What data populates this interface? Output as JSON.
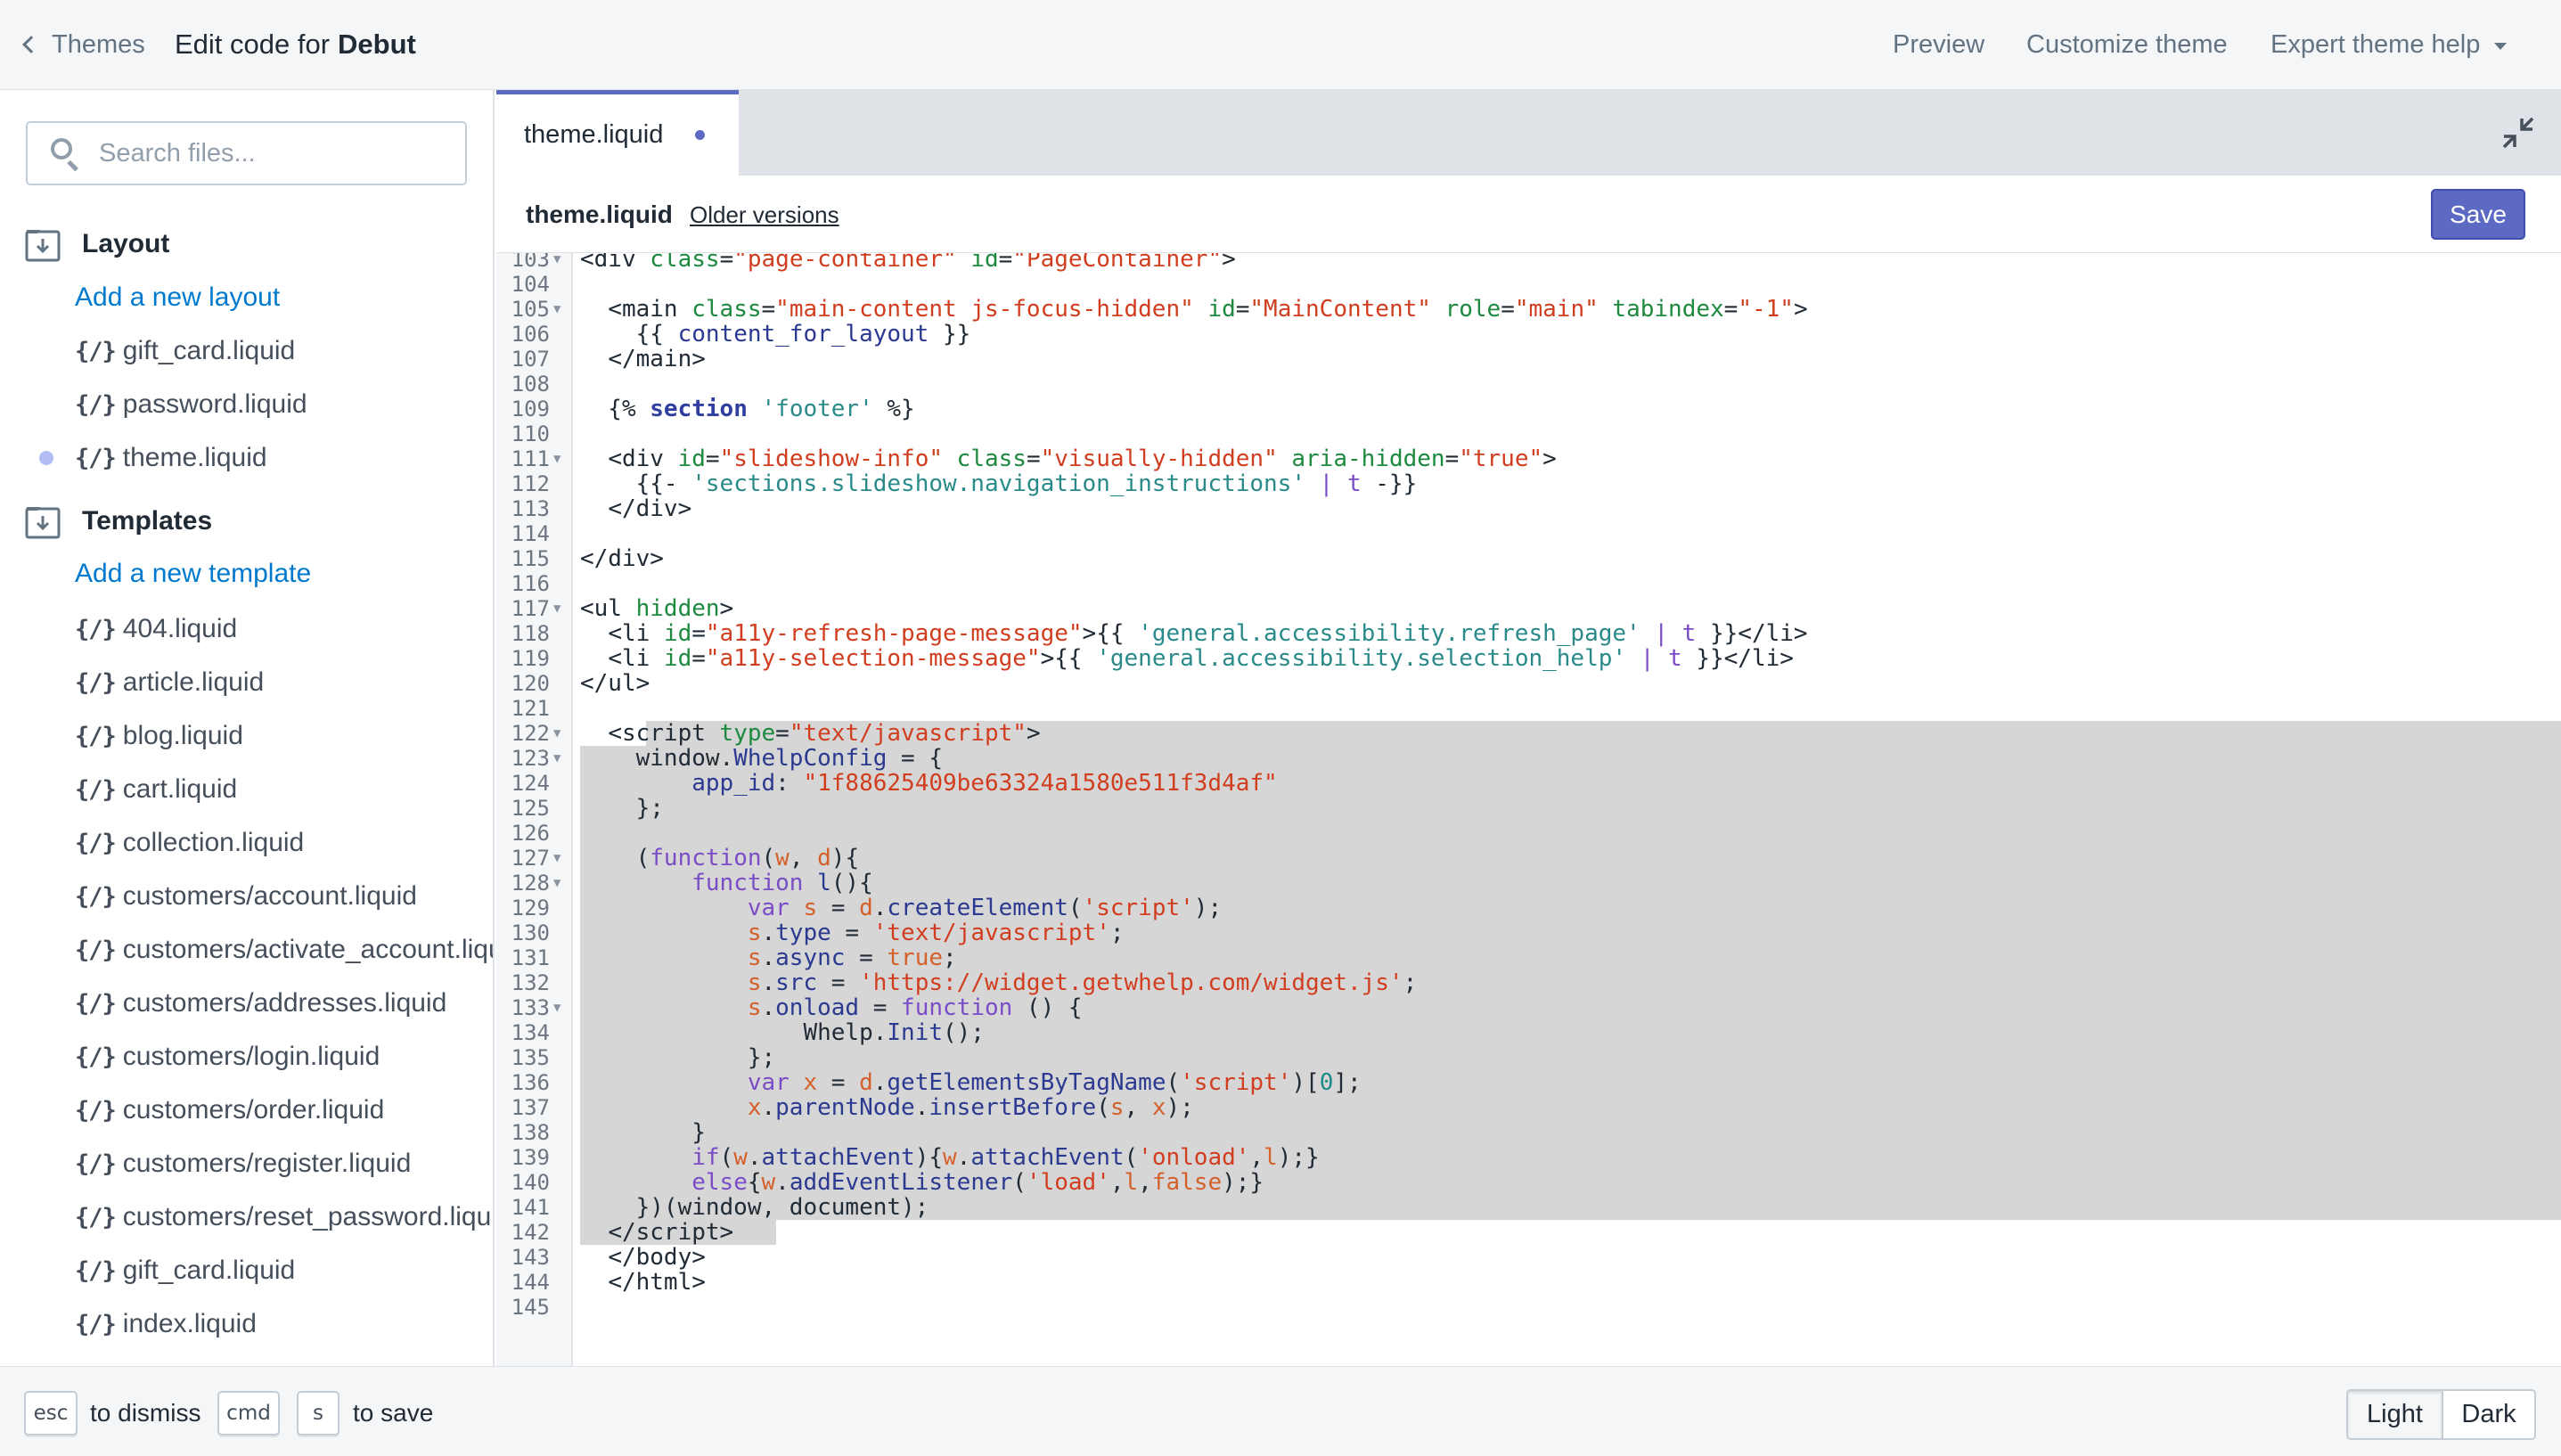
{
  "topbar": {
    "back_label": "Themes",
    "title_prefix": "Edit code for",
    "theme_name": "Debut",
    "nav": {
      "preview": "Preview",
      "customize": "Customize theme",
      "help": "Expert theme help"
    }
  },
  "sidebar": {
    "search_placeholder": "Search files...",
    "layout": {
      "label": "Layout",
      "add_label": "Add a new layout",
      "files": [
        "gift_card.liquid",
        "password.liquid",
        "theme.liquid"
      ]
    },
    "templates": {
      "label": "Templates",
      "add_label": "Add a new template",
      "files": [
        "404.liquid",
        "article.liquid",
        "blog.liquid",
        "cart.liquid",
        "collection.liquid",
        "customers/account.liquid",
        "customers/activate_account.liquid",
        "customers/addresses.liquid",
        "customers/login.liquid",
        "customers/order.liquid",
        "customers/register.liquid",
        "customers/reset_password.liquid",
        "gift_card.liquid",
        "index.liquid"
      ]
    },
    "file_icon": "{/}"
  },
  "editor": {
    "tab_label": "theme.liquid",
    "file_name": "theme.liquid",
    "older_versions": "Older versions",
    "save_label": "Save"
  },
  "code": {
    "line_numbers": [
      "103",
      "104",
      "105",
      "106",
      "107",
      "108",
      "109",
      "110",
      "111",
      "112",
      "113",
      "114",
      "115",
      "116",
      "117",
      "118",
      "119",
      "120",
      "121",
      "122",
      "123",
      "124",
      "125",
      "126",
      "127",
      "128",
      "129",
      "130",
      "131",
      "132",
      "133",
      "134",
      "135",
      "136",
      "137",
      "138",
      "139",
      "140",
      "141",
      "142",
      "143",
      "144",
      "145"
    ]
  },
  "bottombar": {
    "esc_key": "esc",
    "dismiss_text": "to dismiss",
    "cmd_key": "cmd",
    "s_key": "s",
    "save_text": "to save",
    "light_label": "Light",
    "dark_label": "Dark"
  },
  "colors": {
    "accent": "#5c6ac4",
    "link": "#007ace",
    "selection": "#d6d6d6",
    "modified_dot": "#b3bcf5"
  }
}
